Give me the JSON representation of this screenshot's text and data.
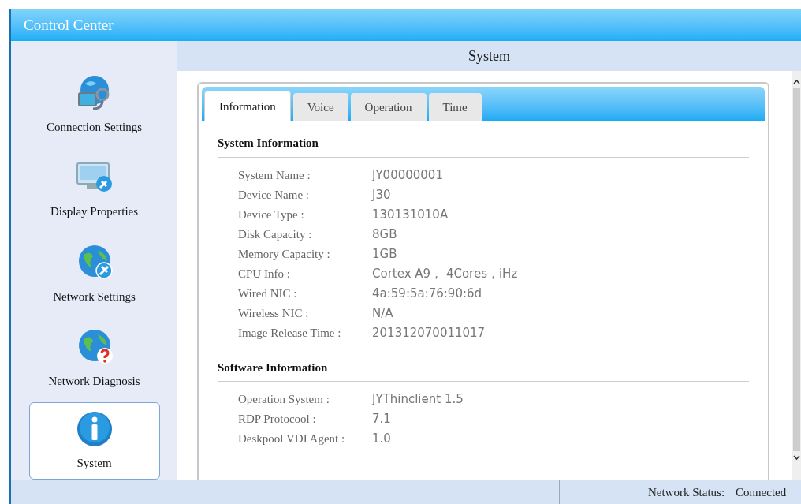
{
  "window": {
    "title": "Control Center"
  },
  "sidebar": {
    "items": [
      {
        "label": "Connection Settings",
        "kind": "connection",
        "selected": false
      },
      {
        "label": "Display Properties",
        "kind": "display",
        "selected": false
      },
      {
        "label": "Network Settings",
        "kind": "network",
        "selected": false
      },
      {
        "label": "Network Diagnosis",
        "kind": "diagnosis",
        "selected": false
      },
      {
        "label": "System",
        "kind": "info",
        "selected": true
      }
    ]
  },
  "header": {
    "title": "System"
  },
  "tabs": [
    {
      "label": "Information",
      "selected": true
    },
    {
      "label": "Voice",
      "selected": false
    },
    {
      "label": "Operation",
      "selected": false
    },
    {
      "label": "Time",
      "selected": false
    }
  ],
  "sections": [
    {
      "title": "System Information",
      "rows": [
        {
          "label": "System Name :",
          "value": "JY00000001"
        },
        {
          "label": "Device Name :",
          "value": "J30"
        },
        {
          "label": "Device Type :",
          "value": "130131010A"
        },
        {
          "label": "Disk Capacity :",
          "value": "8GB"
        },
        {
          "label": "Memory Capacity :",
          "value": "1GB"
        },
        {
          "label": "CPU Info :",
          "value": "Cortex A9， 4Cores，iHz"
        },
        {
          "label": "Wired NIC :",
          "value": "4a:59:5a:76:90:6d"
        },
        {
          "label": "Wireless NIC :",
          "value": "N/A"
        },
        {
          "label": "Image Release Time :",
          "value": "201312070011017"
        }
      ]
    },
    {
      "title": "Software Information",
      "rows": [
        {
          "label": "Operation System :",
          "value": "JYThinclient 1.5"
        },
        {
          "label": "RDP Protocool :",
          "value": "7.1"
        },
        {
          "label": "Deskpool VDI Agent :",
          "value": "1.0"
        }
      ]
    }
  ],
  "status_bar": {
    "label": "Network Status:",
    "value": "Connected"
  }
}
